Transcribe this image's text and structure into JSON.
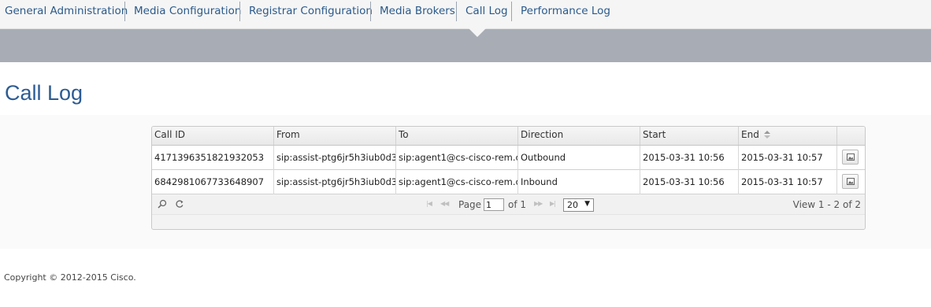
{
  "nav": {
    "items": [
      {
        "label": "General Administration"
      },
      {
        "label": "Media Configuration"
      },
      {
        "label": "Registrar Configuration"
      },
      {
        "label": "Media Brokers"
      },
      {
        "label": "Call Log"
      },
      {
        "label": "Performance Log"
      }
    ],
    "active": "Call Log"
  },
  "page": {
    "title": "Call Log"
  },
  "grid": {
    "columns": [
      "Call ID",
      "From",
      "To",
      "Direction",
      "Start",
      "End"
    ],
    "sortable_column": "End",
    "rows": [
      {
        "call_id": "4171396351821932053",
        "from": "sip:assist-ptg6jr5h3iub0d3",
        "to": "sip:agent1@cs-cisco-rem.c",
        "direction": "Outbound",
        "start": "2015-03-31 10:56",
        "end": "2015-03-31 10:57",
        "action_icon": "image-icon"
      },
      {
        "call_id": "6842981067733648907",
        "from": "sip:assist-ptg6jr5h3iub0d3",
        "to": "sip:agent1@cs-cisco-rem.c",
        "direction": "Inbound",
        "start": "2015-03-31 10:56",
        "end": "2015-03-31 10:57",
        "action_icon": "image-icon"
      }
    ],
    "pager": {
      "page_label": "Page",
      "page_value": "1",
      "of_label": "of 1",
      "page_size": "20",
      "view_text": "View 1 - 2 of 2",
      "tools": [
        "search-icon",
        "refresh-icon"
      ],
      "nav_icons": [
        "first-page-icon",
        "prev-page-icon",
        "next-page-icon",
        "last-page-icon"
      ]
    }
  },
  "footer": {
    "copyright": "Copyright © 2012-2015 Cisco."
  },
  "colors": {
    "nav_text": "#2b5a8a",
    "band": "#a8adb5",
    "title": "#2d5b93"
  }
}
